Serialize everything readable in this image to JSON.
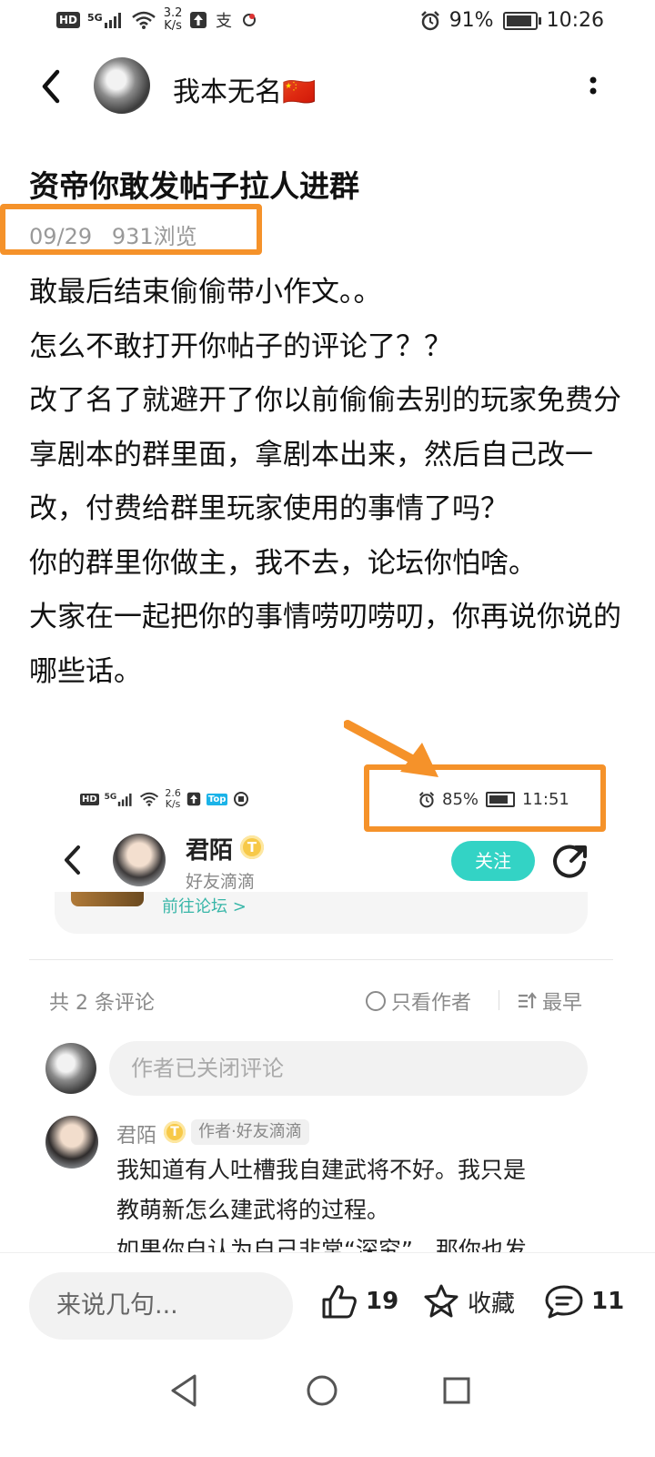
{
  "status_bar": {
    "hd": "HD",
    "network": "5G",
    "speed_value": "3.2",
    "speed_unit": "K/s",
    "battery_percent": "91%",
    "battery_level": 0.91,
    "time": "10:26",
    "icons": [
      "hd-badge-icon",
      "signal-5g-icon",
      "wifi-icon",
      "upload-app-icon",
      "alipay-icon",
      "app-notification-icon",
      "alarm-icon",
      "battery-icon"
    ]
  },
  "header": {
    "author_name": "我本无名🇨🇳"
  },
  "post": {
    "title": "资帝你敢发帖子拉人进群",
    "date": "09/29",
    "views": "931浏览",
    "paragraphs": [
      "敢最后结束偷偷带小作文。。",
      "怎么不敢打开你帖子的评论了？？",
      "改了名了就避开了你以前偷偷去别的玩家免费分享剧本的群里面，拿剧本出来，然后自己改一改，付费给群里玩家使用的事情了吗？",
      "你的群里你做主，我不去，论坛你怕啥。",
      "大家在一起把你的事情唠叨唠叨，你再说你说的哪些话。"
    ]
  },
  "embedded": {
    "status_bar": {
      "hd": "HD",
      "network": "5G",
      "speed_value": "2.6",
      "speed_unit": "K/s",
      "top_badge": "Top",
      "battery_percent": "85%",
      "battery_level": 0.85,
      "time": "11:51"
    },
    "user": {
      "name": "君陌",
      "level_badge": "T",
      "subtitle": "好友滴滴",
      "follow_label": "关注"
    },
    "forum_link": "前往论坛 >",
    "comments_header": {
      "count_label": "共 2 条评论",
      "only_author_label": "只看作者",
      "sort_label": "最早"
    },
    "closed_placeholder": "作者已关闭评论",
    "comment": {
      "name": "君陌",
      "level_badge": "T",
      "tag": "作者·好友滴滴",
      "lines": [
        "我知道有人吐槽我自建武将不好。我只是",
        "教萌新怎么建武将的过程。",
        "如果你自认为自己非常“深究”，那你也发"
      ]
    }
  },
  "bottom_bar": {
    "input_placeholder": "来说几句...",
    "like_count": "19",
    "favorite_label": "收藏",
    "comment_count": "11"
  },
  "colors": {
    "highlight": "#f5922a",
    "accent": "#33d3c5"
  }
}
